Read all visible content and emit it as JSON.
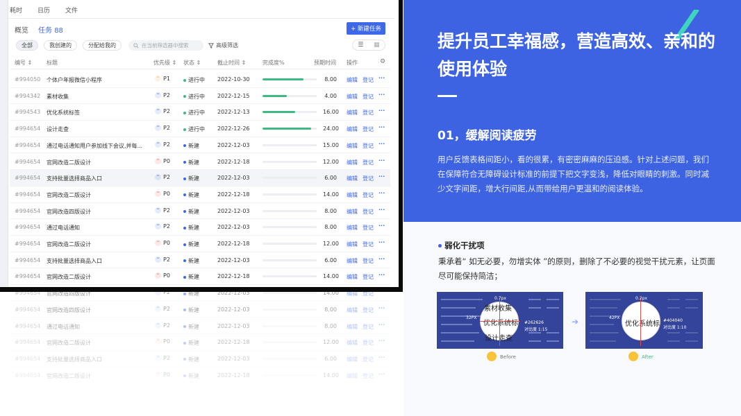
{
  "app": {
    "nav_tabs": [
      "耗时",
      "日历",
      "文件"
    ],
    "view_tabs": {
      "overview": "概览",
      "tasks": "任务",
      "task_count": "88"
    },
    "new_task_button": "+ 新建任务",
    "filters": [
      "全部",
      "我创建的",
      "分配给我的"
    ],
    "search_placeholder": "在当前筛选器中搜索",
    "advanced_filter": "高级筛选",
    "columns": {
      "id": "编号 ⇕",
      "title": "标题",
      "priority": "优先级 ⇕",
      "status": "状态 ⇕",
      "deadline": "截止时间 ⇕",
      "progress": "完成度%",
      "estimate": "预期时间",
      "action": "操作"
    },
    "action_edit": "编辑",
    "action_log": "登记",
    "colors": {
      "accent": "#3d68e8",
      "progress": "#3dba84",
      "status_active": "#3dba84",
      "status_new": "#3d68e8",
      "p0": "#e25c5c",
      "p1": "#f2a23a",
      "p2": "#3d68e8"
    },
    "rows": [
      {
        "id": "#994050",
        "title": "个体户年报微信小程序",
        "priority": "P1",
        "status": "进行中",
        "deadline": "2022-10-30",
        "progress": 0.75,
        "hours": "8.00"
      },
      {
        "id": "#994342",
        "title": "素材收集",
        "priority": "P2",
        "status": "进行中",
        "deadline": "2022-12-15",
        "progress": 0.45,
        "hours": "4.00"
      },
      {
        "id": "#994543",
        "title": "优化系统标签",
        "priority": "P2",
        "status": "进行中",
        "deadline": "2022-12-13",
        "progress": 0.6,
        "hours": "16.00"
      },
      {
        "id": "#994654",
        "title": "设计走查",
        "priority": "P2",
        "status": "进行中",
        "deadline": "2022-12-26",
        "progress": 0.9,
        "hours": "24.00"
      },
      {
        "id": "#994654",
        "title": "通过电话通知用户参加线下会议,并每...",
        "priority": "P2",
        "status": "新建",
        "deadline": "2022-12-03",
        "progress": 0,
        "hours": "15.00"
      },
      {
        "id": "#994654",
        "title": "官网改造二版设计",
        "priority": "P0",
        "status": "新建",
        "deadline": "2022-12-18",
        "progress": 0,
        "hours": "12.00"
      },
      {
        "id": "#994654",
        "title": "支持批量选择商品入口",
        "priority": "P2",
        "status": "新建",
        "deadline": "2022-12-03",
        "progress": 0,
        "hours": "6.00"
      },
      {
        "id": "#994654",
        "title": "官网改造二版设计",
        "priority": "P0",
        "status": "新建",
        "deadline": "2022-12-18",
        "progress": 0,
        "hours": "14.00"
      },
      {
        "id": "#994654",
        "title": "官网改造四版设计",
        "priority": "P2",
        "status": "新建",
        "deadline": "2022-12-03",
        "progress": 0,
        "hours": "8.00"
      },
      {
        "id": "#994654",
        "title": "通过电话通知",
        "priority": "P2",
        "status": "新建",
        "deadline": "2022-12-03",
        "progress": 0,
        "hours": "8.00"
      },
      {
        "id": "#994654",
        "title": "官网改造二版设计",
        "priority": "P0",
        "status": "新建",
        "deadline": "2022-12-18",
        "progress": 0,
        "hours": "12.00"
      },
      {
        "id": "#994654",
        "title": "支持批量选择商品入口",
        "priority": "P2",
        "status": "新建",
        "deadline": "2022-12-03",
        "progress": 0,
        "hours": "6.00"
      },
      {
        "id": "#994654",
        "title": "官网改造二版设计",
        "priority": "P0",
        "status": "新建",
        "deadline": "2022-12-18",
        "progress": 0,
        "hours": "14.00"
      },
      {
        "id": "#994654",
        "title": "官网改造四版设计",
        "priority": "P2",
        "status": "新建",
        "deadline": "2022-12-03",
        "progress": 0,
        "hours": "14.00"
      },
      {
        "id": "#994654",
        "title": "官网改造四版设计",
        "priority": "P2",
        "status": "新建",
        "deadline": "2022-12-03",
        "progress": 0,
        "hours": "8.00"
      },
      {
        "id": "#994654",
        "title": "通过电话通知",
        "priority": "P2",
        "status": "新建",
        "deadline": "2022-12-03",
        "progress": 0,
        "hours": "8.00"
      },
      {
        "id": "#994654",
        "title": "官网改造二版设计",
        "priority": "P0",
        "status": "新建",
        "deadline": "2022-12-18",
        "progress": 0,
        "hours": "12.00"
      },
      {
        "id": "#994654",
        "title": "支持批量选择商品入口",
        "priority": "P2",
        "status": "新建",
        "deadline": "2022-12-03",
        "progress": 0,
        "hours": "6.00"
      },
      {
        "id": "#994654",
        "title": "官网改造二版设计",
        "priority": "P0",
        "status": "新建",
        "deadline": "2022-12-18",
        "progress": 0,
        "hours": "14.00"
      }
    ]
  },
  "hero": {
    "title": "提升员工幸福感，营造高效、亲和的使用体验",
    "section_title": "01，缓解阅读疲劳",
    "section_body": "用户反馈表格间距小，看的很累，有密密麻麻的压迫感。针对上述问题，我们在保障符合无障碍设计标准的前提下把文字变浅，降低对眼睛的刺激。同时减少文字间距，增大行间距,从而带给用户更温和的阅读体验。",
    "background_color": "#3d63e3"
  },
  "sub": {
    "heading": "弱化干扰项",
    "body": "秉承着“ 如无必要，勿增实体 ”的原则，删除了不必要的视觉干扰元素，让页面尽可能保持简洁；",
    "before": {
      "label": "Before",
      "top_note": "0.7px",
      "side_note": "32PX",
      "circle_lines": [
        "素材收集",
        "优化系统标",
        "设计走查"
      ],
      "color_note": "#262626",
      "ratio_note": "对比度 1:15"
    },
    "after": {
      "label": "After",
      "top_note": "0.2px",
      "side_note": "42PX",
      "circle_lines": [
        "优化系统标"
      ],
      "color_note": "#404040",
      "ratio_note": "对比度 1:10"
    },
    "colors": {
      "after_label": "#3dba84"
    }
  }
}
